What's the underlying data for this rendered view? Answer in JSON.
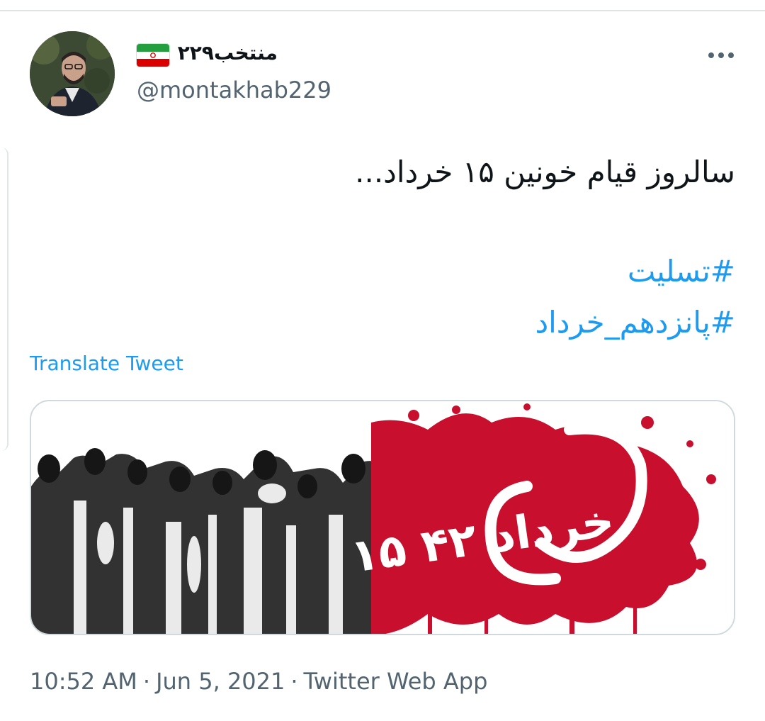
{
  "tweet": {
    "display_name": "منتخب۲۲۹",
    "handle": "@montakhab229",
    "text": "سالروز قیام خونین ۱۵ خرداد...",
    "hashtags": [
      "#تسلیت",
      "#پانزدهم_خرداد"
    ],
    "translate_label": "Translate Tweet",
    "time": "10:52 AM",
    "date": "Jun 5, 2021",
    "separator": "·",
    "source": "Twitter Web App",
    "more_icon": "more-horizontal-icon"
  },
  "media": {
    "image_text": "۱۵ خرداد ۴۲",
    "colors": {
      "blood_red": "#c8102e",
      "ink": "#111111"
    }
  },
  "colors": {
    "link": "#1d9bf0",
    "secondary": "#536471",
    "border": "#cfd9de",
    "flag_green": "#239f40",
    "flag_red": "#da0000"
  }
}
